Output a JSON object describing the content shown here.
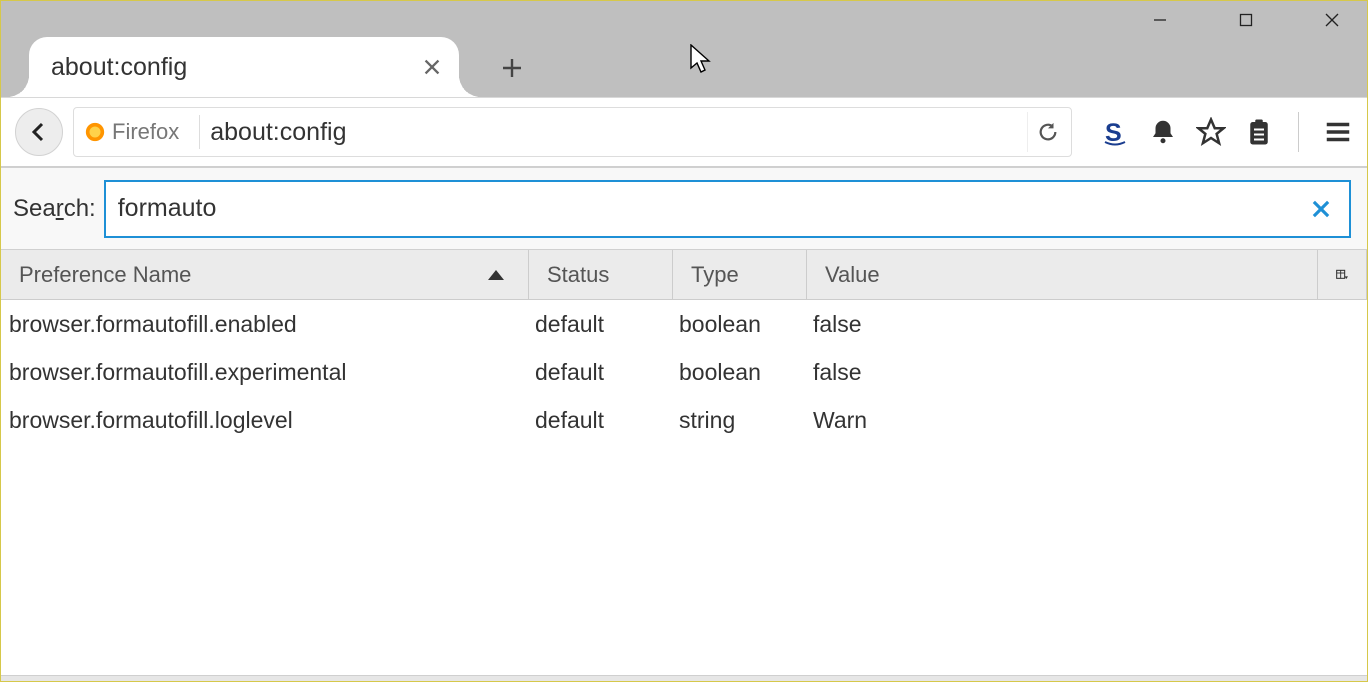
{
  "window": {
    "tab_title": "about:config",
    "identity_label": "Firefox",
    "url": "about:config"
  },
  "search": {
    "label_pre": "Sea",
    "label_ul": "r",
    "label_post": "ch:",
    "value": "formauto"
  },
  "columns": {
    "name": "Preference Name",
    "status": "Status",
    "type": "Type",
    "value": "Value"
  },
  "rows": [
    {
      "name": "browser.formautofill.enabled",
      "status": "default",
      "type": "boolean",
      "value": "false"
    },
    {
      "name": "browser.formautofill.experimental",
      "status": "default",
      "type": "boolean",
      "value": "false"
    },
    {
      "name": "browser.formautofill.loglevel",
      "status": "default",
      "type": "string",
      "value": "Warn"
    }
  ]
}
